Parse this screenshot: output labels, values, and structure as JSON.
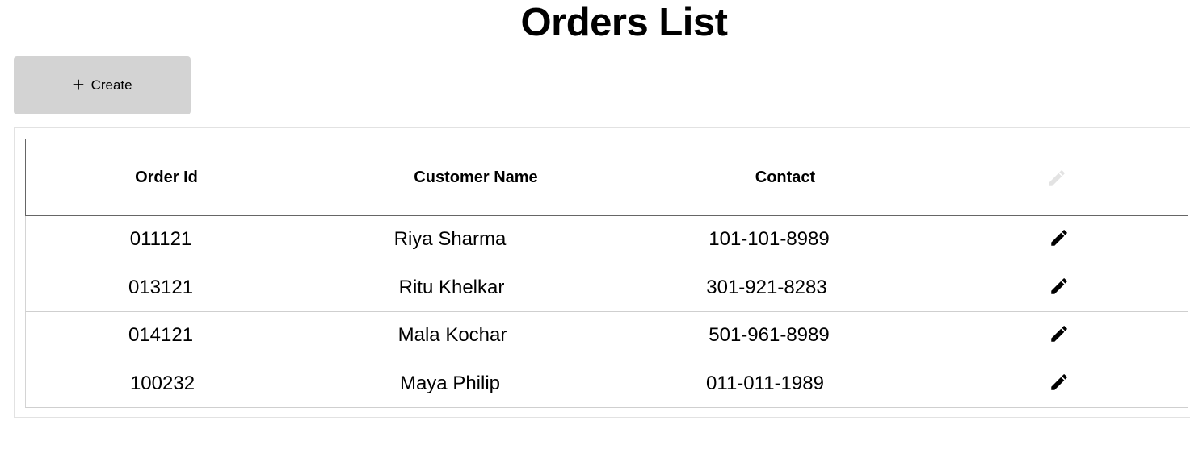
{
  "page": {
    "title": "Orders List"
  },
  "toolbar": {
    "create_label": "Create",
    "create_icon": "plus-icon"
  },
  "table": {
    "columns": {
      "order_id": "Order Id",
      "customer_name": "Customer Name",
      "contact": "Contact",
      "actions_icon": "edit-icon"
    },
    "rows": [
      {
        "order_id": "011121",
        "customer_name": "Riya Sharma",
        "contact": "101-101-8989"
      },
      {
        "order_id": "013121",
        "customer_name": "Ritu Khelkar",
        "contact": "301-921-8283"
      },
      {
        "order_id": "014121",
        "customer_name": "Mala Kochar",
        "contact": "501-961-8989"
      },
      {
        "order_id": "100232",
        "customer_name": "Maya Philip",
        "contact": "011-011-1989"
      }
    ]
  },
  "colors": {
    "button_bg": "#d3d3d3",
    "header_border": "#666666",
    "row_border": "#cfcfcf",
    "disabled_icon": "#e3e3e3"
  }
}
